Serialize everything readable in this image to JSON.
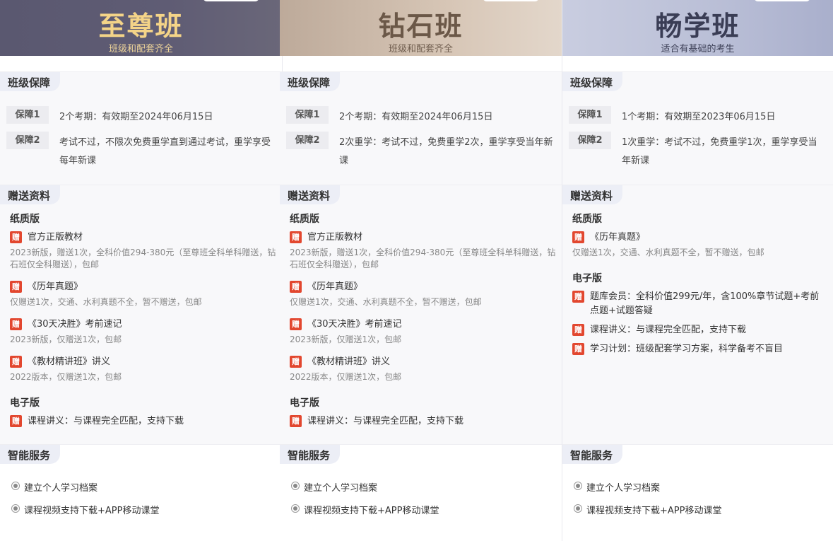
{
  "columns": [
    {
      "title": "至尊班",
      "subtitle": "班级和配套齐全",
      "guarantee_head": "班级保障",
      "guarantees": [
        {
          "tag": "保障1",
          "text": "2个考期：有效期至2024年06月15日"
        },
        {
          "tag": "保障2",
          "text": "考试不过，不限次免费重学直到通过考试，重学享受每年新课"
        }
      ],
      "gift_head": "赠送资料",
      "paper_head": "纸质版",
      "gifts": [
        {
          "badge": "赠",
          "name": "官方正版教材",
          "desc": "2023新版，赠送1次，全科价值294-380元（至尊班全科单科赠送，钻石班仅全科赠送），包邮"
        },
        {
          "badge": "赠",
          "name": "《历年真题》",
          "desc": "仅赠送1次，交通、水利真题不全，暂不赠送，包邮"
        },
        {
          "badge": "赠",
          "name": "《30天决胜》考前速记",
          "desc": "2023新版，仅赠送1次，包邮"
        },
        {
          "badge": "赠",
          "name": "《教材精讲班》讲义",
          "desc": "2022版本，仅赠送1次，包邮"
        }
      ],
      "ebook_head": "电子版",
      "ebooks": [
        {
          "badge": "赠",
          "name": "课程讲义：与课程完全匹配，支持下载"
        }
      ],
      "service_head": "智能服务",
      "services": [
        "建立个人学习档案",
        "课程视频支持下载+APP移动课堂"
      ]
    },
    {
      "title": "钻石班",
      "subtitle": "班级和配套齐全",
      "guarantee_head": "班级保障",
      "guarantees": [
        {
          "tag": "保障1",
          "text": "2个考期：有效期至2024年06月15日"
        },
        {
          "tag": "保障2",
          "text": "2次重学：考试不过，免费重学2次，重学享受当年新课"
        }
      ],
      "gift_head": "赠送资料",
      "paper_head": "纸质版",
      "gifts": [
        {
          "badge": "赠",
          "name": "官方正版教材",
          "desc": "2023新版，赠送1次，全科价值294-380元（至尊班全科单科赠送，钻石班仅全科赠送），包邮"
        },
        {
          "badge": "赠",
          "name": "《历年真题》",
          "desc": "仅赠送1次，交通、水利真题不全，暂不赠送，包邮"
        },
        {
          "badge": "赠",
          "name": "《30天决胜》考前速记",
          "desc": "2023新版，仅赠送1次，包邮"
        },
        {
          "badge": "赠",
          "name": "《教材精讲班》讲义",
          "desc": "2022版本，仅赠送1次，包邮"
        }
      ],
      "ebook_head": "电子版",
      "ebooks": [
        {
          "badge": "赠",
          "name": "课程讲义：与课程完全匹配，支持下载"
        }
      ],
      "service_head": "智能服务",
      "services": [
        "建立个人学习档案",
        "课程视频支持下载+APP移动课堂"
      ]
    },
    {
      "title": "畅学班",
      "subtitle": "适合有基础的考生",
      "guarantee_head": "班级保障",
      "guarantees": [
        {
          "tag": "保障1",
          "text": "1个考期：有效期至2023年06月15日"
        },
        {
          "tag": "保障2",
          "text": "1次重学：考试不过，免费重学1次，重学享受当年新课"
        }
      ],
      "gift_head": "赠送资料",
      "paper_head": "纸质版",
      "gifts": [
        {
          "badge": "赠",
          "name": "《历年真题》",
          "desc": "仅赠送1次，交通、水利真题不全，暂不赠送，包邮"
        }
      ],
      "ebook_head": "电子版",
      "ebooks": [
        {
          "badge": "赠",
          "name": "题库会员：全科价值299元/年，含100%章节试题+考前点题+试题答疑"
        },
        {
          "badge": "赠",
          "name": "课程讲义：与课程完全匹配，支持下载"
        },
        {
          "badge": "赠",
          "name": "学习计划：班级配套学习方案，科学备考不盲目"
        }
      ],
      "service_head": "智能服务",
      "services": [
        "建立个人学习档案",
        "课程视频支持下载+APP移动课堂"
      ]
    }
  ]
}
